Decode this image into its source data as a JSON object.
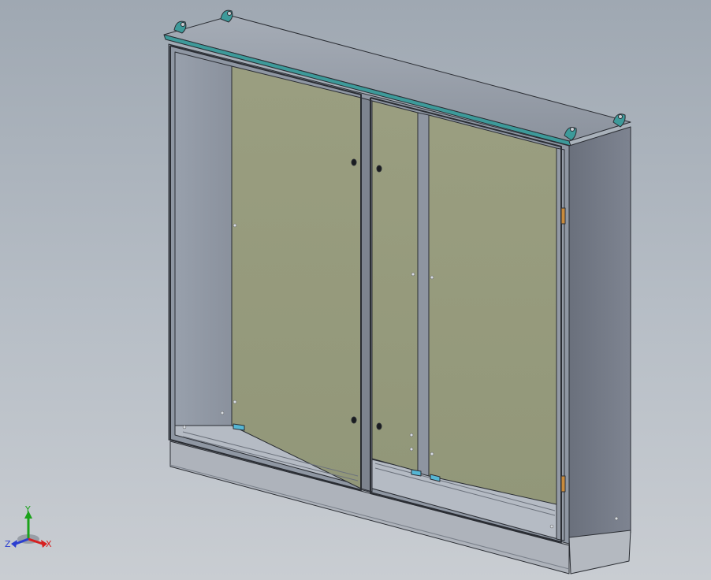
{
  "view": {
    "model": "cabinet-enclosure",
    "display_mode": "shaded-with-edges",
    "background_gradient": [
      "#9fa8b2",
      "#c9cdd2"
    ]
  },
  "triad": {
    "x_label": "X",
    "y_label": "Y",
    "z_label": "Z",
    "x_color": "#d62020",
    "y_color": "#1aa21a",
    "z_color": "#2c3fd0"
  },
  "colors": {
    "enclosure_gray": "#8f97a3",
    "side_panel": "#6f7582",
    "mounting_plate": "#969b7d",
    "gasket_teal": "#3d9a9a",
    "hinge_orange": "#c88a3c",
    "base_plinth": "#aeb3bb"
  }
}
